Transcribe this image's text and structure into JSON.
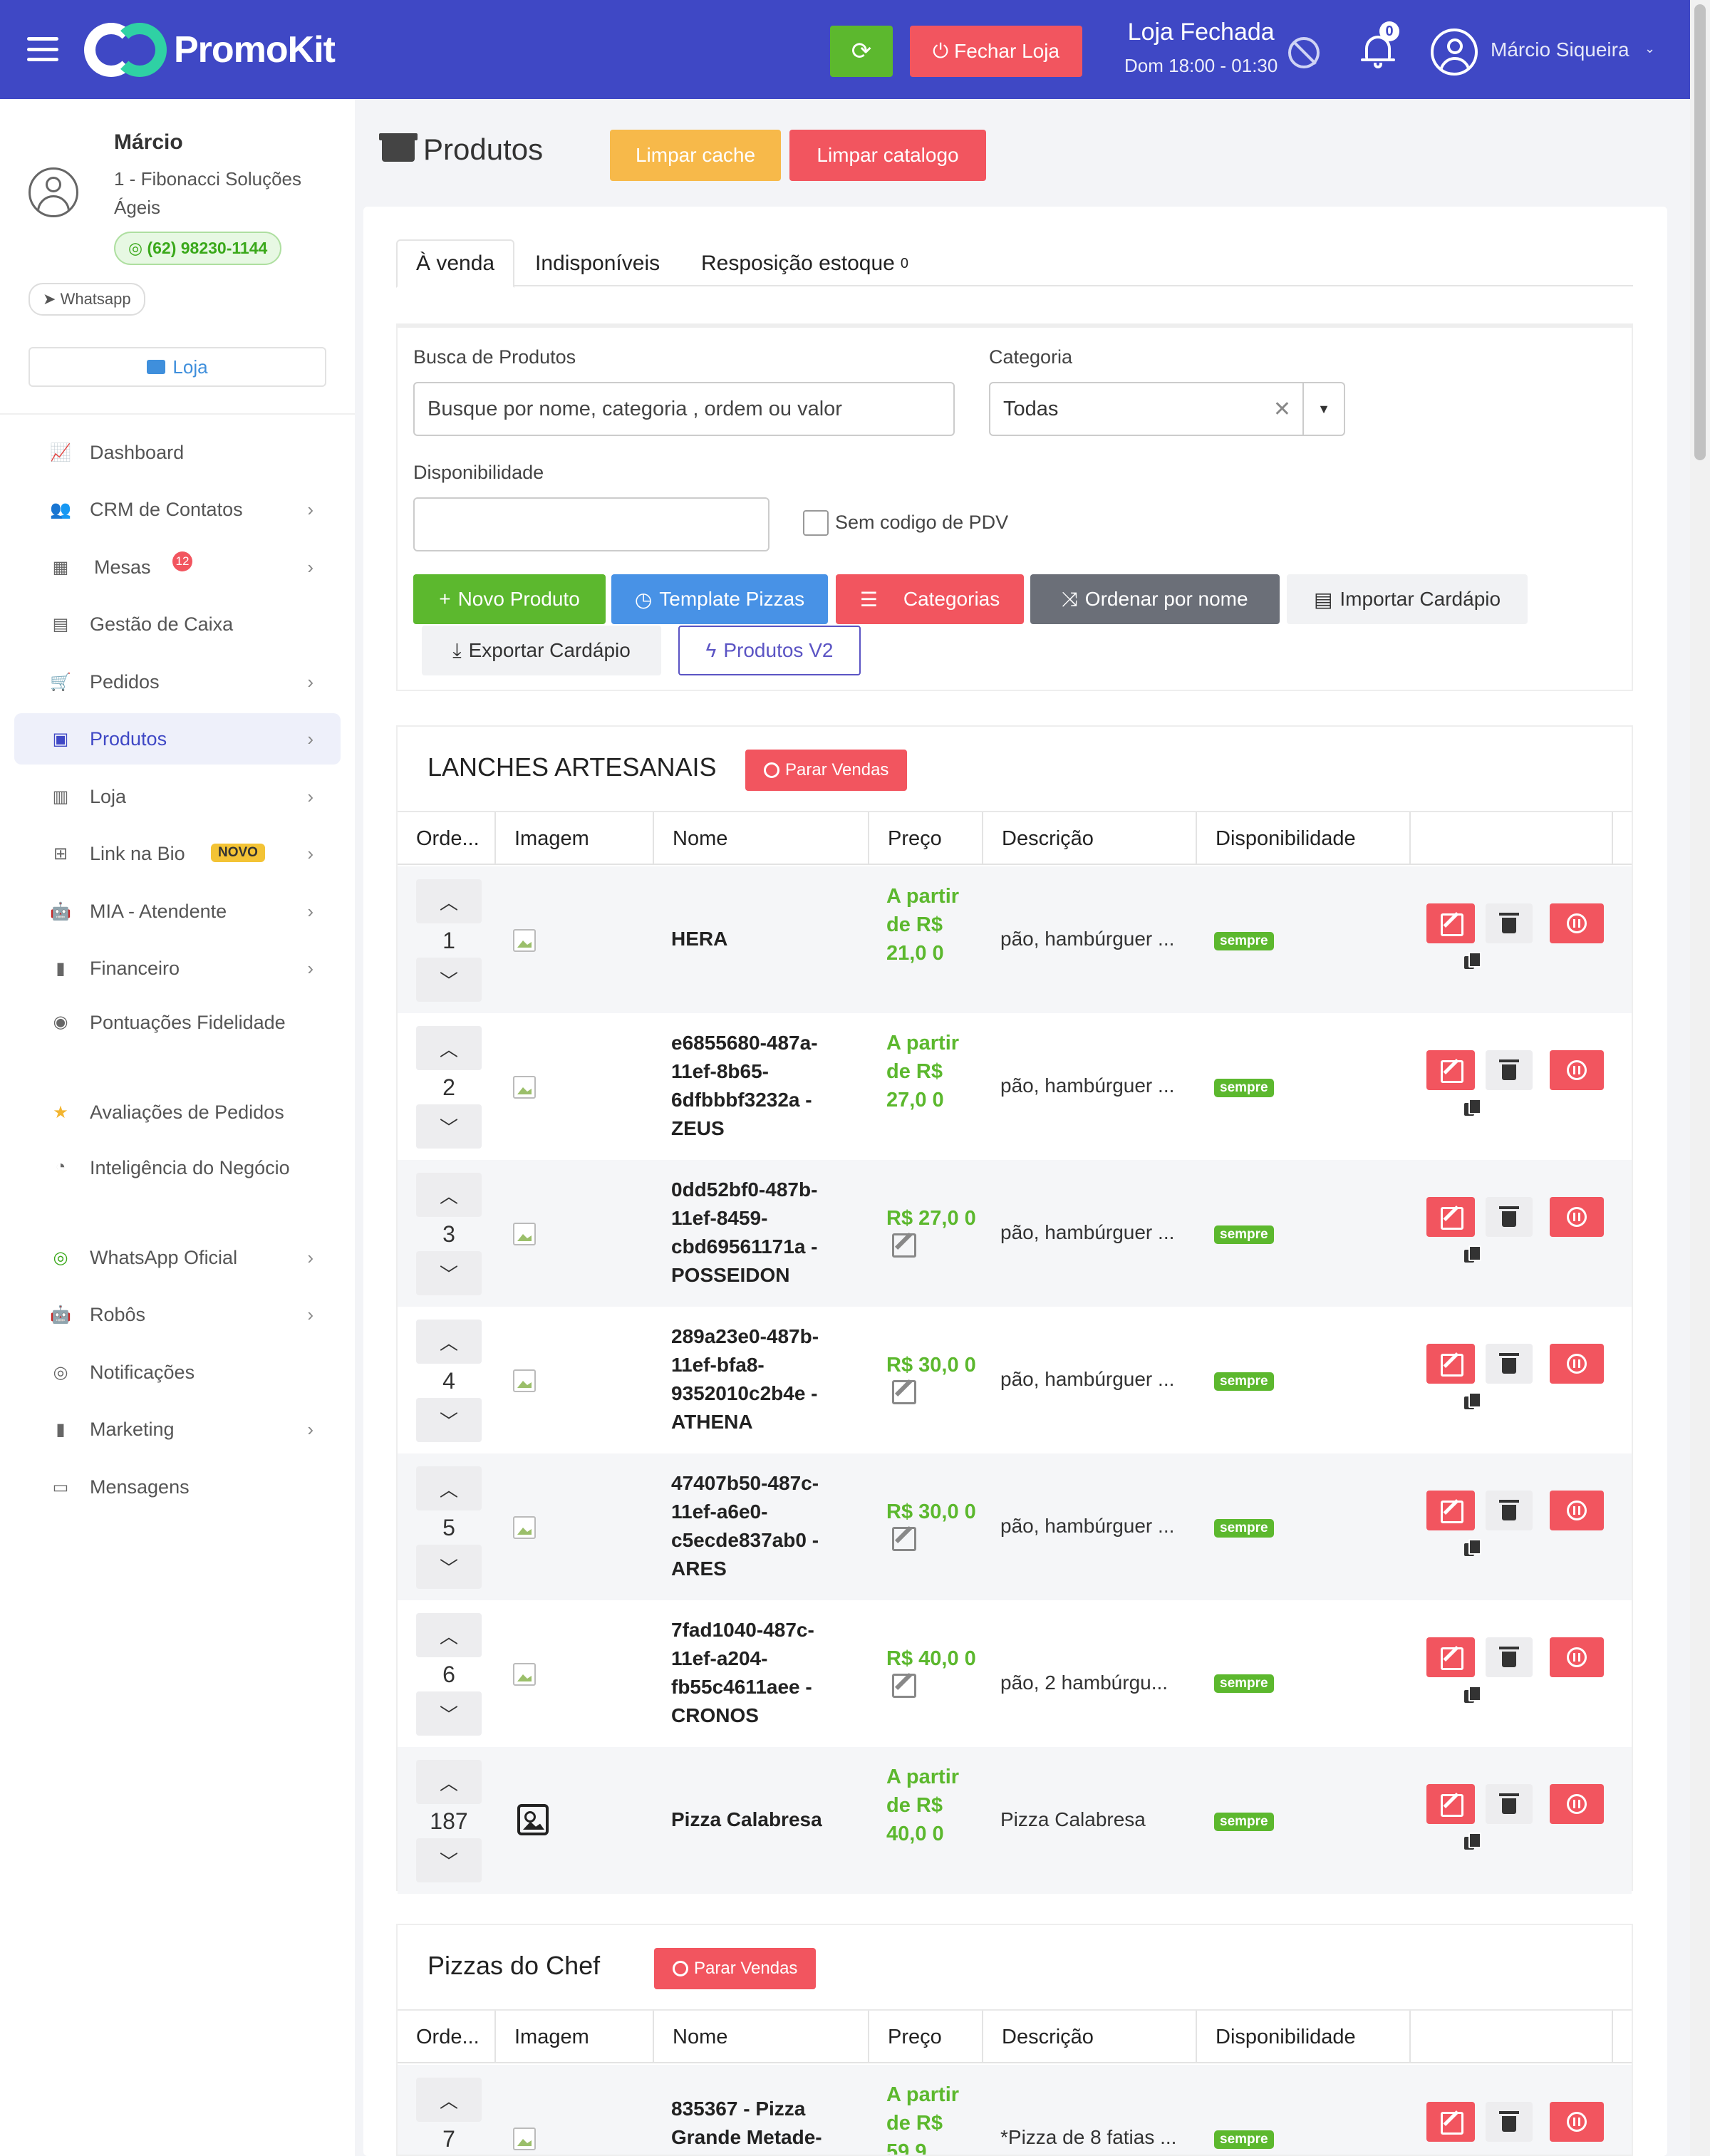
{
  "topbar": {
    "brand": "PromoKit",
    "close_store_label": "Fechar Loja",
    "store_status": "Loja Fechada",
    "store_hours": "Dom 18:00 - 01:30",
    "notifications_count": "0",
    "user_name": "Márcio Siqueira",
    "accent_color": "#3f48c5"
  },
  "sidebar": {
    "profile": {
      "name": "Márcio",
      "company": "1 - Fibonacci Soluções Ágeis",
      "phone": "(62) 98230-1144",
      "whatsapp_label": "Whatsapp",
      "store_button": "Loja"
    },
    "items": [
      {
        "label": "Dashboard",
        "icon": "chart-line-icon"
      },
      {
        "label": "CRM de Contatos",
        "icon": "users-icon"
      },
      {
        "label": "Mesas",
        "icon": "table-icon",
        "badge": "12"
      },
      {
        "label": "Gestão de Caixa",
        "icon": "cash-register-icon"
      },
      {
        "label": "Pedidos",
        "icon": "cart-icon"
      },
      {
        "label": "Produtos",
        "icon": "box-open-icon",
        "active": true
      },
      {
        "label": "Loja",
        "icon": "building-icon"
      },
      {
        "label": "Link na Bio",
        "icon": "sitemap-icon",
        "badge": "NOVO"
      },
      {
        "label": "MIA - Atendente",
        "icon": "robot-icon"
      },
      {
        "label": "Financeiro",
        "icon": "bar-chart-icon"
      },
      {
        "label": "Pontuações Fidelidade",
        "icon": "medal-icon"
      },
      {
        "label": "Avaliações de Pedidos",
        "icon": "star-icon"
      },
      {
        "label": "Inteligência do Negócio",
        "icon": "pie-chart-icon"
      },
      {
        "label": "WhatsApp Oficial",
        "icon": "whatsapp-icon"
      },
      {
        "label": "Robôs",
        "icon": "robot-icon"
      },
      {
        "label": "Notificações",
        "icon": "whatsapp-icon"
      },
      {
        "label": "Marketing",
        "icon": "bar-chart-icon"
      },
      {
        "label": "Mensagens",
        "icon": "inbox-icon"
      }
    ]
  },
  "main": {
    "title": "Produtos",
    "clear_cache": "Limpar cache",
    "clear_catalog": "Limpar catalogo",
    "tabs": [
      {
        "label": "À venda"
      },
      {
        "label": "Indisponíveis"
      },
      {
        "label": "Resposição estoque",
        "count": "0"
      }
    ],
    "filters": {
      "search_label": "Busca de Produtos",
      "search_placeholder": "Busque por nome, categoria , ordem ou valor",
      "category_label": "Categoria",
      "category_value": "Todas",
      "availability_label": "Disponibilidade",
      "no_pdv_label": "Sem codigo de PDV"
    },
    "actions": {
      "new_product": "Novo Produto",
      "template_pizzas": "Template Pizzas",
      "categories": "Categorias",
      "order_by_name": "Ordenar por nome",
      "import_menu": "Importar Cardápio",
      "export_menu": "Exportar Cardápio",
      "products_v2": "Produtos V2"
    },
    "table_headers": [
      "Orde...",
      "Imagem",
      "Nome",
      "Preço",
      "Descrição",
      "Disponibilidade"
    ],
    "stop_sales_label": "Parar Vendas",
    "sections": [
      {
        "title": "LANCHES ARTESANAIS",
        "rows": [
          {
            "order": "1",
            "name": "HERA",
            "price": "A partir de R$ 21,0 0",
            "description": "pão, hambúrguer ...",
            "availability": "sempre"
          },
          {
            "order": "2",
            "name": "e6855680-487a-11ef-8b65-6dfbbbf3232a - ZEUS",
            "price": "A partir de R$ 27,0 0",
            "description": "pão, hambúrguer ...",
            "availability": "sempre"
          },
          {
            "order": "3",
            "name": "0dd52bf0-487b-11ef-8459-cbd69561171a - POSSEIDON",
            "price": "R$ 27,0 0",
            "description": "pão, hambúrguer ...",
            "availability": "sempre"
          },
          {
            "order": "4",
            "name": "289a23e0-487b-11ef-bfa8-9352010c2b4e - ATHENA",
            "price": "R$ 30,0 0",
            "description": "pão, hambúrguer ...",
            "availability": "sempre"
          },
          {
            "order": "5",
            "name": "47407b50-487c-11ef-a6e0-c5ecde837ab0 - ARES",
            "price": "R$ 30,0 0",
            "description": "pão, hambúrguer ...",
            "availability": "sempre"
          },
          {
            "order": "6",
            "name": "7fad1040-487c-11ef-a204-fb55c4611aee - CRONOS",
            "price": "R$ 40,0 0",
            "description": "pão, 2 hambúrgu...",
            "availability": "sempre"
          },
          {
            "order": "187",
            "name": "Pizza Calabresa",
            "price": "A partir de R$ 40,0 0",
            "description": "Pizza Calabresa",
            "availability": "sempre"
          }
        ]
      },
      {
        "title": "Pizzas do Chef",
        "rows": [
          {
            "order": "7",
            "name": "835367 - Pizza Grande Metade-",
            "price": "A partir de R$ 59,9",
            "description": "*Pizza de 8 fatias ...",
            "availability": "sempre"
          }
        ]
      }
    ]
  }
}
